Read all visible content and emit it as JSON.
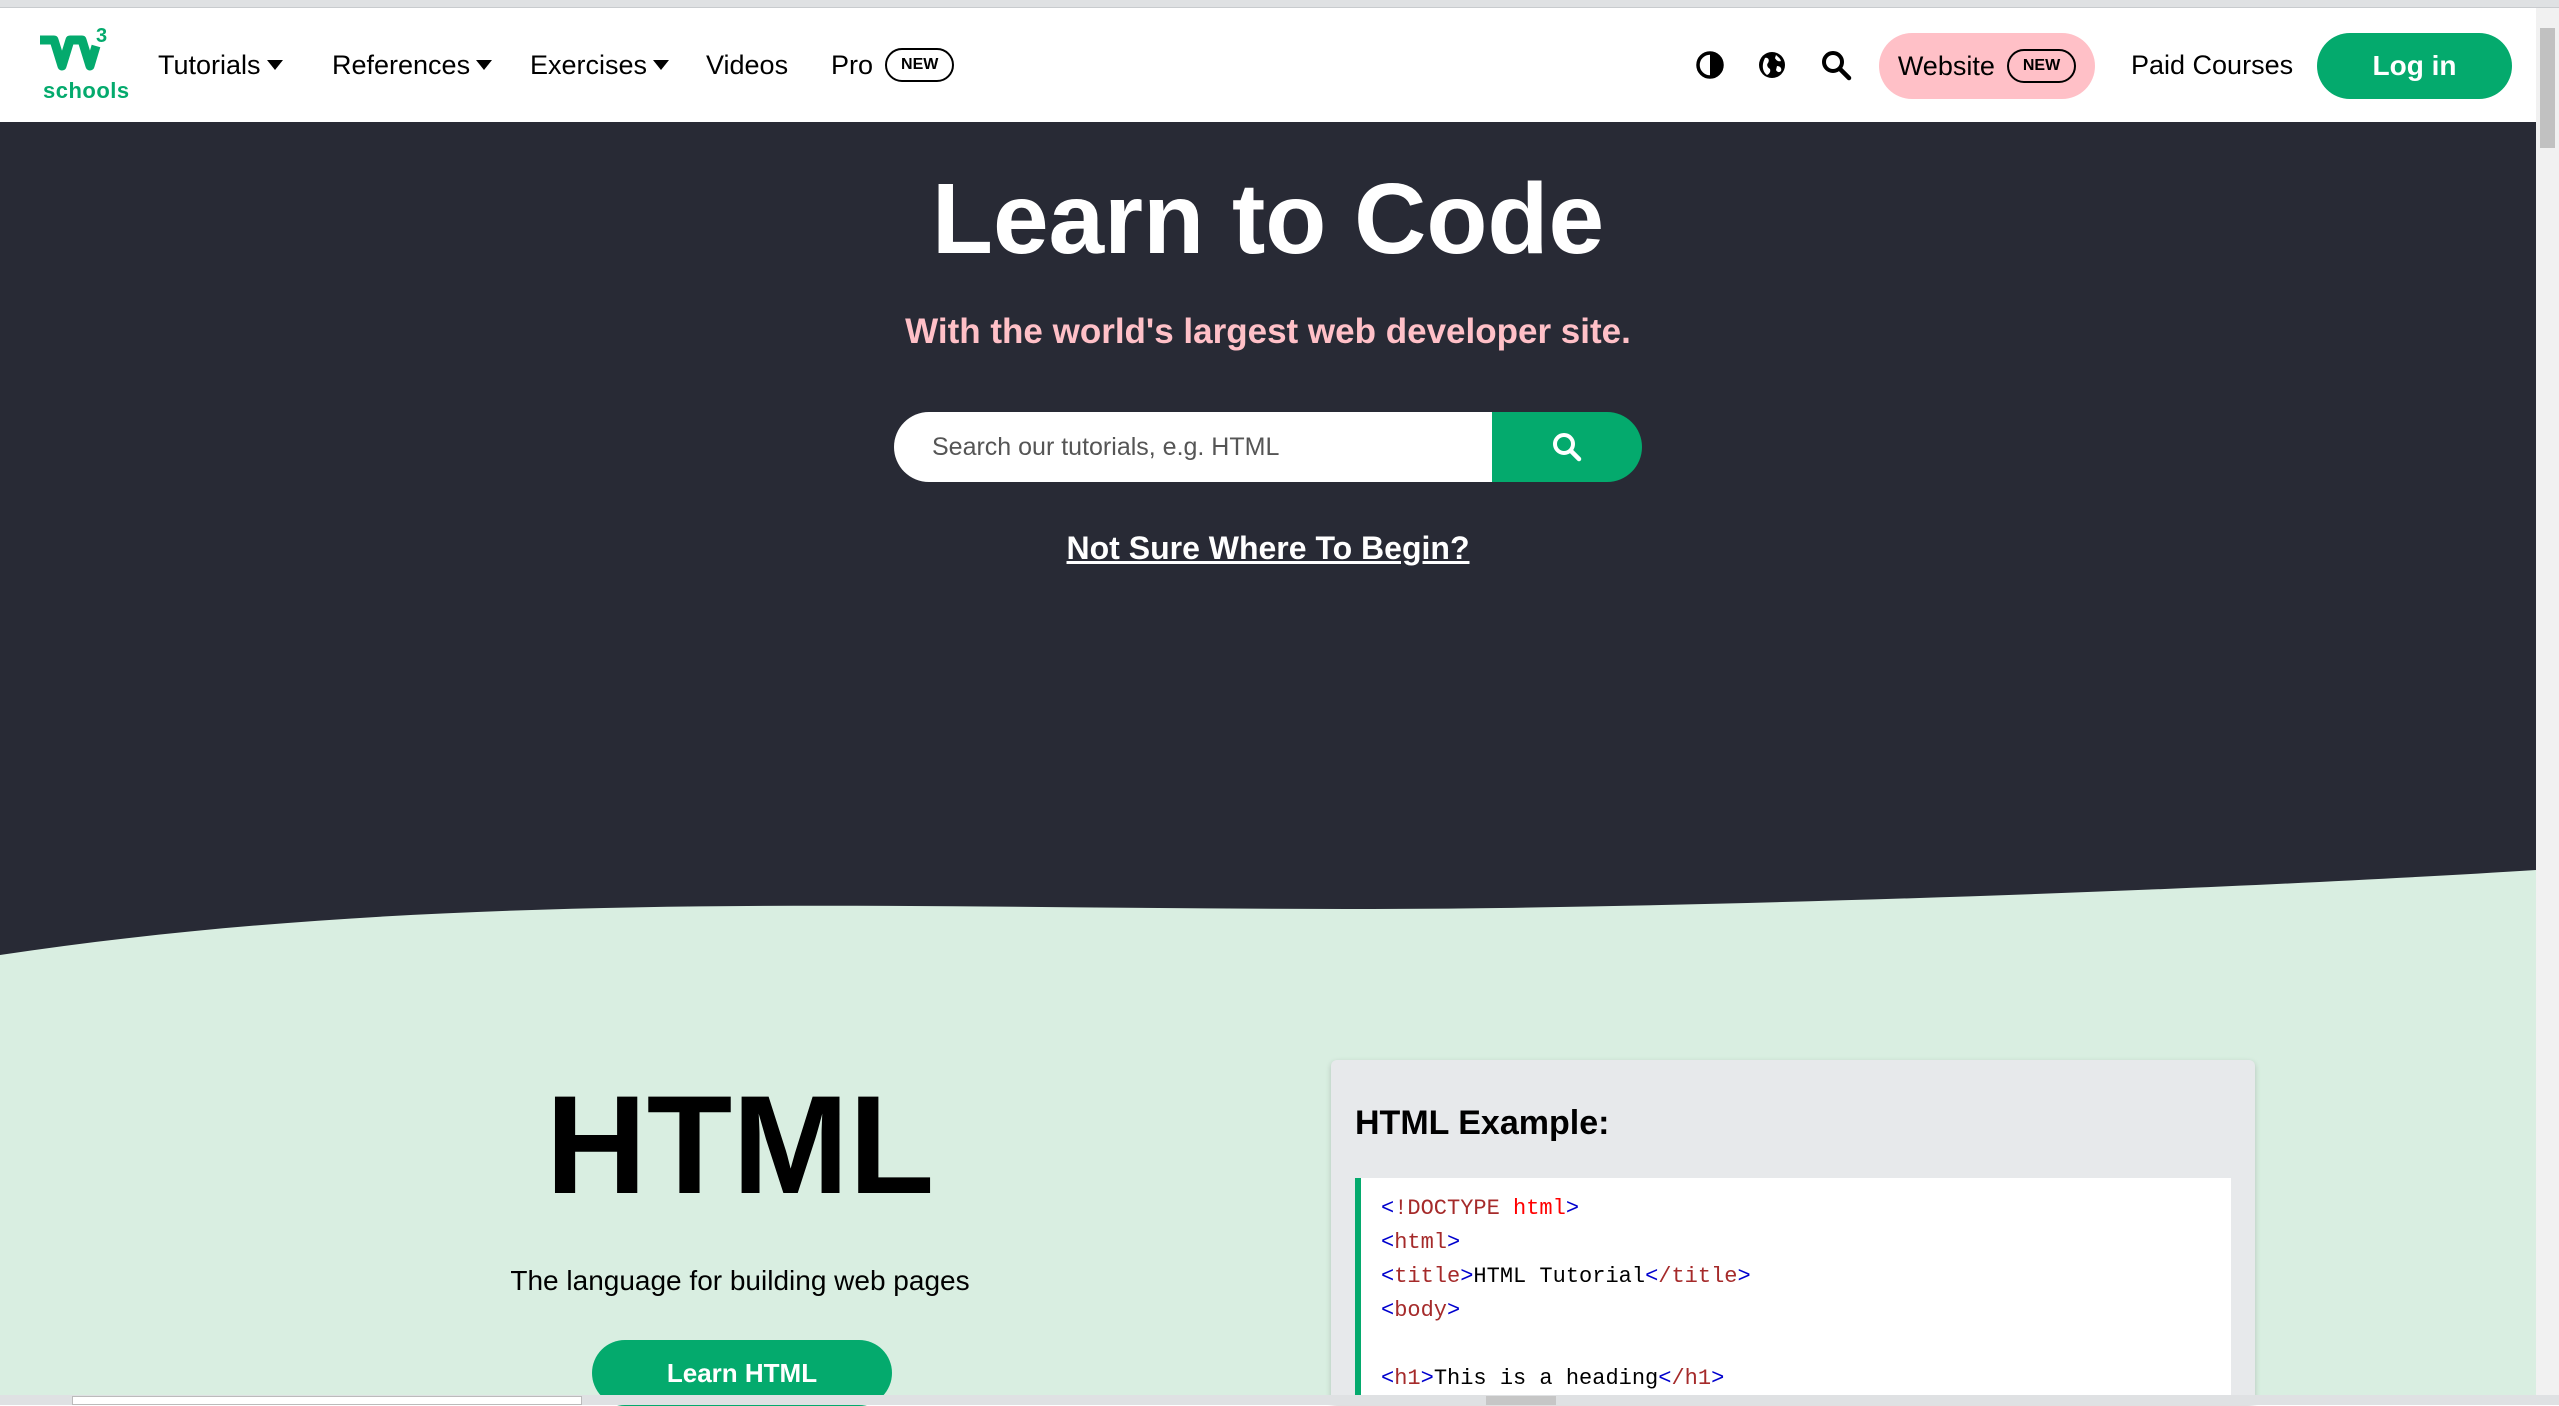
{
  "nav": {
    "logo_text": "schools",
    "logo_sup": "3",
    "items": [
      {
        "label": "Tutorials"
      },
      {
        "label": "References"
      },
      {
        "label": "Exercises"
      },
      {
        "label": "Videos"
      },
      {
        "label": "Pro"
      }
    ],
    "pro_badge": "NEW",
    "icons": [
      "contrast-icon",
      "globe-icon",
      "search-icon"
    ],
    "website_label": "Website",
    "website_badge": "NEW",
    "paid_courses": "Paid Courses",
    "login": "Log in"
  },
  "hero": {
    "title": "Learn to Code",
    "subtitle": "With the world's largest web developer site.",
    "search_placeholder": "Search our tutorials, e.g. HTML",
    "link": "Not Sure Where To Begin?"
  },
  "section": {
    "title": "HTML",
    "subtitle": "The language for building web pages",
    "button": "Learn HTML",
    "example_title": "HTML Example:"
  },
  "colors": {
    "brand_green": "#04AA6D",
    "hero_bg": "#282A35",
    "pink": "#FFC0C7",
    "section_bg": "#D9EEE1"
  }
}
